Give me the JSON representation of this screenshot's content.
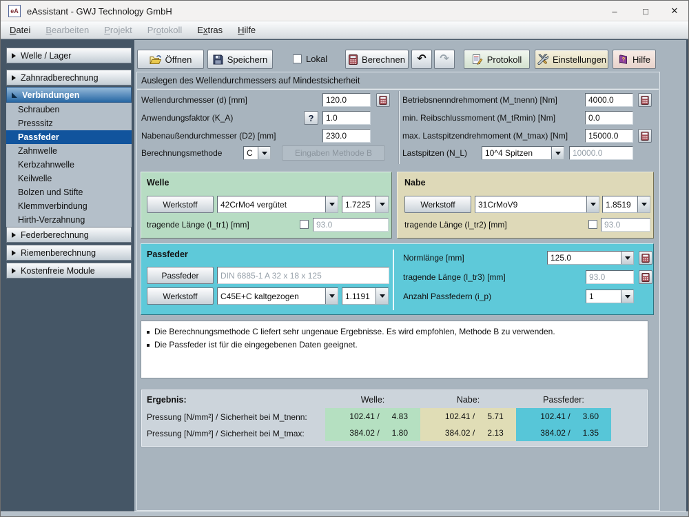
{
  "window": {
    "title": "eAssistant - GWJ Technology GmbH",
    "icon_label": "eA",
    "controls": {
      "minimize": "–",
      "maximize": "□",
      "close": "✕"
    }
  },
  "menu": {
    "items": [
      {
        "label": "Datei",
        "mnemonic": 0,
        "enabled": true
      },
      {
        "label": "Bearbeiten",
        "mnemonic": 0,
        "enabled": false
      },
      {
        "label": "Projekt",
        "mnemonic": 0,
        "enabled": false
      },
      {
        "label": "Protokoll",
        "mnemonic": 2,
        "enabled": false
      },
      {
        "label": "Extras",
        "mnemonic": 1,
        "enabled": true
      },
      {
        "label": "Hilfe",
        "mnemonic": 0,
        "enabled": true
      }
    ]
  },
  "sidebar": {
    "sections": [
      {
        "label": "Welle / Lager"
      },
      {
        "label": "Zahnradberechnung"
      },
      {
        "label": "Verbindungen",
        "expanded": true
      },
      {
        "label": "Federberechnung"
      },
      {
        "label": "Riemenberechnung"
      },
      {
        "label": "Kostenfreie Module"
      }
    ],
    "verbindungen_items": [
      "Schrauben",
      "Presssitz",
      "Passfeder",
      "Zahnwelle",
      "Kerbzahnwelle",
      "Keilwelle",
      "Bolzen und Stifte",
      "Klemmverbindung",
      "Hirth-Verzahnung"
    ],
    "selected_item": "Passfeder"
  },
  "toolbar": {
    "open": "Öffnen",
    "save": "Speichern",
    "local_label": "Lokal",
    "calculate": "Berechnen",
    "protocol": "Protokoll",
    "settings": "Einstellungen",
    "help": "Hilfe"
  },
  "icons": {
    "undo": "↶",
    "redo": "↷",
    "help_button": "?"
  },
  "subtitle": "Auslegen des Wellendurchmessers auf Mindestsicherheit",
  "params_left": {
    "rows": [
      {
        "label": "Wellendurchmesser (d) [mm]",
        "value": "120.0"
      },
      {
        "label": "Anwendungsfaktor (K_A)",
        "value": "1.0"
      },
      {
        "label": "Nabenaußendurchmesser (D2) [mm]",
        "value": "230.0"
      },
      {
        "label": "Berechnungsmethode",
        "value": "C",
        "button": "Eingaben Methode B"
      }
    ]
  },
  "params_right": {
    "rows": [
      {
        "label": "Betriebsnenndrehmoment (M_tnenn) [Nm]",
        "value": "4000.0"
      },
      {
        "label": "min. Reibschlussmoment (M_tRmin) [Nm]",
        "value": "0.0"
      },
      {
        "label": "max. Lastspitzendrehmoment (M_tmax) [Nm]",
        "value": "15000.0"
      },
      {
        "label": "Lastspitzen (N_L)",
        "value": "10^4 Spitzen",
        "value2": "10000.0"
      }
    ]
  },
  "welle": {
    "title": "Welle",
    "material_button": "Werkstoff",
    "material": "42CrMo4 vergütet",
    "material_number": "1.7225",
    "length_label": "tragende Länge (l_tr1) [mm]",
    "length_value": "93.0"
  },
  "nabe": {
    "title": "Nabe",
    "material_button": "Werkstoff",
    "material": "31CrMoV9",
    "material_number": "1.8519",
    "length_label": "tragende Länge (l_tr2) [mm]",
    "length_value": "93.0"
  },
  "passfeder": {
    "title": "Passfeder",
    "passfeder_button": "Passfeder",
    "designation": "DIN 6885-1 A 32 x 18 x 125",
    "material_button": "Werkstoff",
    "material": "C45E+C kaltgezogen",
    "material_number": "1.1191",
    "norm_length_label": "Normlänge [mm]",
    "norm_length_value": "125.0",
    "length_label": "tragende Länge (l_tr3) [mm]",
    "length_value": "93.0",
    "count_label": "Anzahl Passfedern (i_p)",
    "count_value": "1"
  },
  "messages": [
    "Die Berechnungsmethode C liefert sehr ungenaue Ergebnisse. Es wird empfohlen, Methode B zu verwenden.",
    "Die Passfeder ist für die eingegebenen Daten geeignet."
  ],
  "results": {
    "title": "Ergebnis:",
    "columns": [
      "Welle:",
      "Nabe:",
      "Passfeder:"
    ],
    "rows": [
      {
        "label": "Pressung [N/mm²] / Sicherheit bei M_tnenn:",
        "welle_p": "102.41 /",
        "welle_s": "4.83",
        "nabe_p": "102.41 /",
        "nabe_s": "5.71",
        "pf_p": "102.41 /",
        "pf_s": "3.60"
      },
      {
        "label": "Pressung [N/mm²] / Sicherheit bei M_tmax:",
        "welle_p": "384.02 /",
        "welle_s": "1.80",
        "nabe_p": "384.02 /",
        "nabe_s": "2.13",
        "pf_p": "384.02 /",
        "pf_s": "1.35"
      }
    ]
  },
  "colors": {
    "welle_panel": "#b7dcc3",
    "nabe_panel": "#ded9b8",
    "passfeder_panel": "#5ec9d9",
    "selected_nav": "#11549d",
    "results_welle": "#b5e0c1",
    "results_nabe": "#e0ddb6",
    "results_passfeder": "#57c6d8"
  }
}
